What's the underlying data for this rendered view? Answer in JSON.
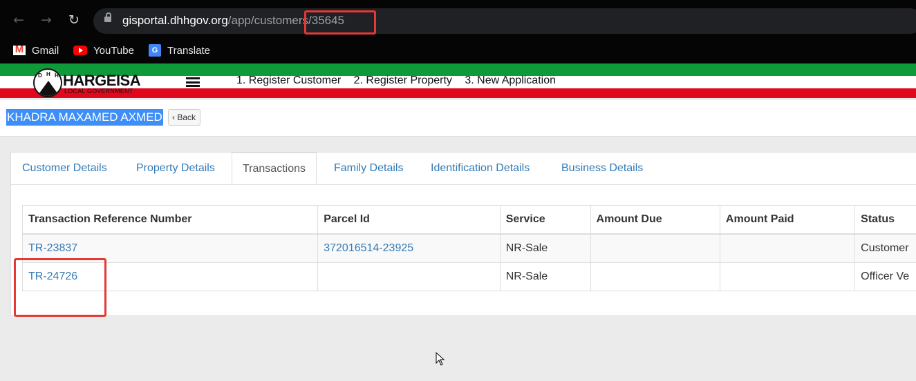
{
  "browser": {
    "url_domain": "gisportal.dhhgov.org",
    "url_path": "/app/customers/35645",
    "bookmarks": [
      {
        "label": "Gmail",
        "icon": "gmail-icon"
      },
      {
        "label": "YouTube",
        "icon": "youtube-icon"
      },
      {
        "label": "Translate",
        "icon": "translate-icon"
      }
    ]
  },
  "site": {
    "logo_name": "HARGEISA",
    "logo_sub": "LOCAL GOVERNMENT",
    "logo_letters": [
      "D",
      "H",
      "H"
    ],
    "nav": [
      "1. Register Customer",
      "2. Register Property",
      "3. New Application"
    ]
  },
  "customer": {
    "name": "KHADRA MAXAMED AXMED",
    "back_label": "Back"
  },
  "tabs": [
    {
      "label": "Customer Details",
      "active": false
    },
    {
      "label": "Property Details",
      "active": false
    },
    {
      "label": "Transactions",
      "active": true
    },
    {
      "label": "Family Details",
      "active": false
    },
    {
      "label": "Identification Details",
      "active": false
    },
    {
      "label": "Business Details",
      "active": false
    }
  ],
  "table": {
    "columns": [
      "Transaction Reference Number",
      "Parcel Id",
      "Service",
      "Amount Due",
      "Amount Paid",
      "Status"
    ],
    "rows": [
      [
        "TR-23837",
        "372016514-23925",
        "NR-Sale",
        "",
        "",
        "Customer"
      ],
      [
        "TR-24726",
        "",
        "NR-Sale",
        "",
        "",
        "Officer Ve"
      ]
    ]
  },
  "colors": {
    "accent_link": "#337ab7",
    "highlight": "#e53935",
    "flag_green": "#0f9a3a",
    "flag_red": "#e0081c"
  }
}
